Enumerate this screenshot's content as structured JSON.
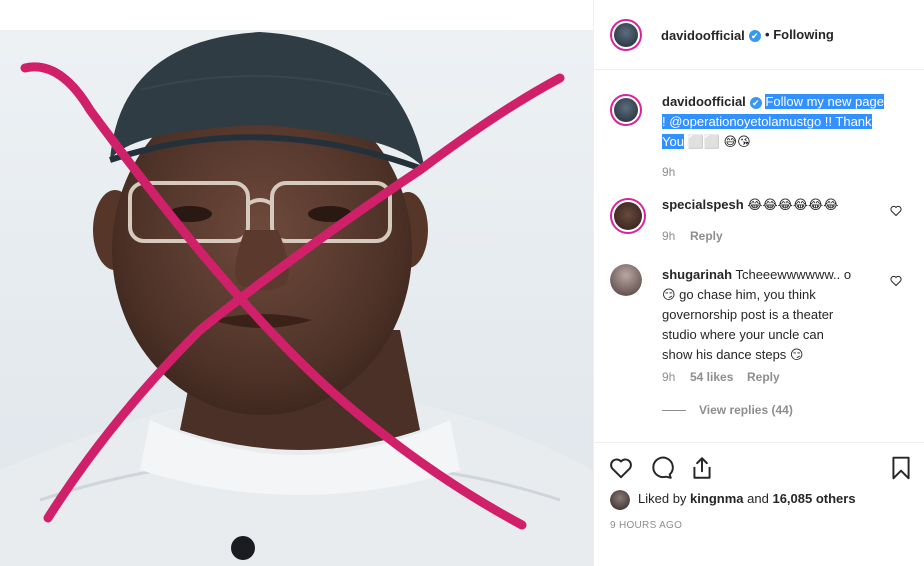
{
  "post": {
    "author": "davidoofficial",
    "follow_separator": "•",
    "follow_label": "Following"
  },
  "caption": {
    "author": "davidoofficial",
    "line1": "Follow my new page",
    "line2": "! @operationoyetolamustgo !! Thank",
    "line3": "You",
    "emojis_tail": "⬜⬜ 😅😘",
    "time": "9h"
  },
  "comments": [
    {
      "author": "specialspesh",
      "text": "😂😂😂😂😂😂",
      "time": "9h",
      "reply_label": "Reply"
    },
    {
      "author": "shugarinah",
      "line1": "Tcheeewwwwww.. o",
      "line2": "😏 go chase him, you think",
      "line3": "governorship post is a theater",
      "line4": "studio where your uncle can",
      "line5": "show his dance steps 😏",
      "time": "9h",
      "likes": "54 likes",
      "reply_label": "Reply",
      "view_replies": "View replies (44)"
    }
  ],
  "likes": {
    "prefix": "Liked by",
    "user": "kingnma",
    "middle": "and",
    "count": "16,085 others"
  },
  "timestamp": "9 HOURS AGO",
  "colors": {
    "ring": "#d6249f",
    "verified": "#3897f0",
    "highlight": "#3390ff",
    "x_mark": "#d1206a"
  },
  "icons": [
    "heart-icon",
    "comment-icon",
    "share-icon",
    "bookmark-icon",
    "verified-icon"
  ]
}
